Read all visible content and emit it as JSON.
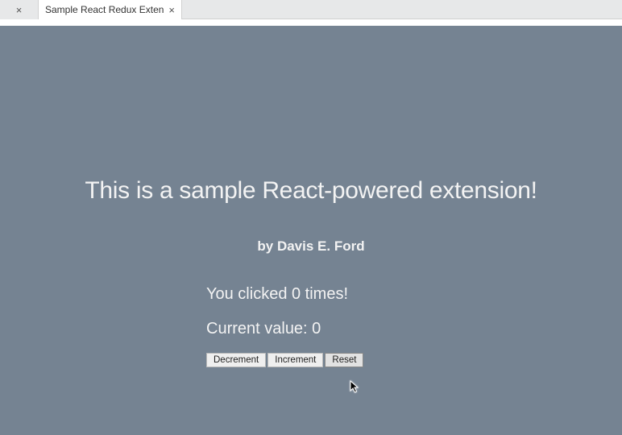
{
  "tabs": {
    "active_title": "Sample React Redux Exten"
  },
  "page": {
    "headline": "This is a sample React-powered extension!",
    "byline": "by Davis E. Ford",
    "click_line": "You clicked 0 times!",
    "value_line": "Current value: 0"
  },
  "buttons": {
    "decrement": "Decrement",
    "increment": "Increment",
    "reset": "Reset"
  }
}
